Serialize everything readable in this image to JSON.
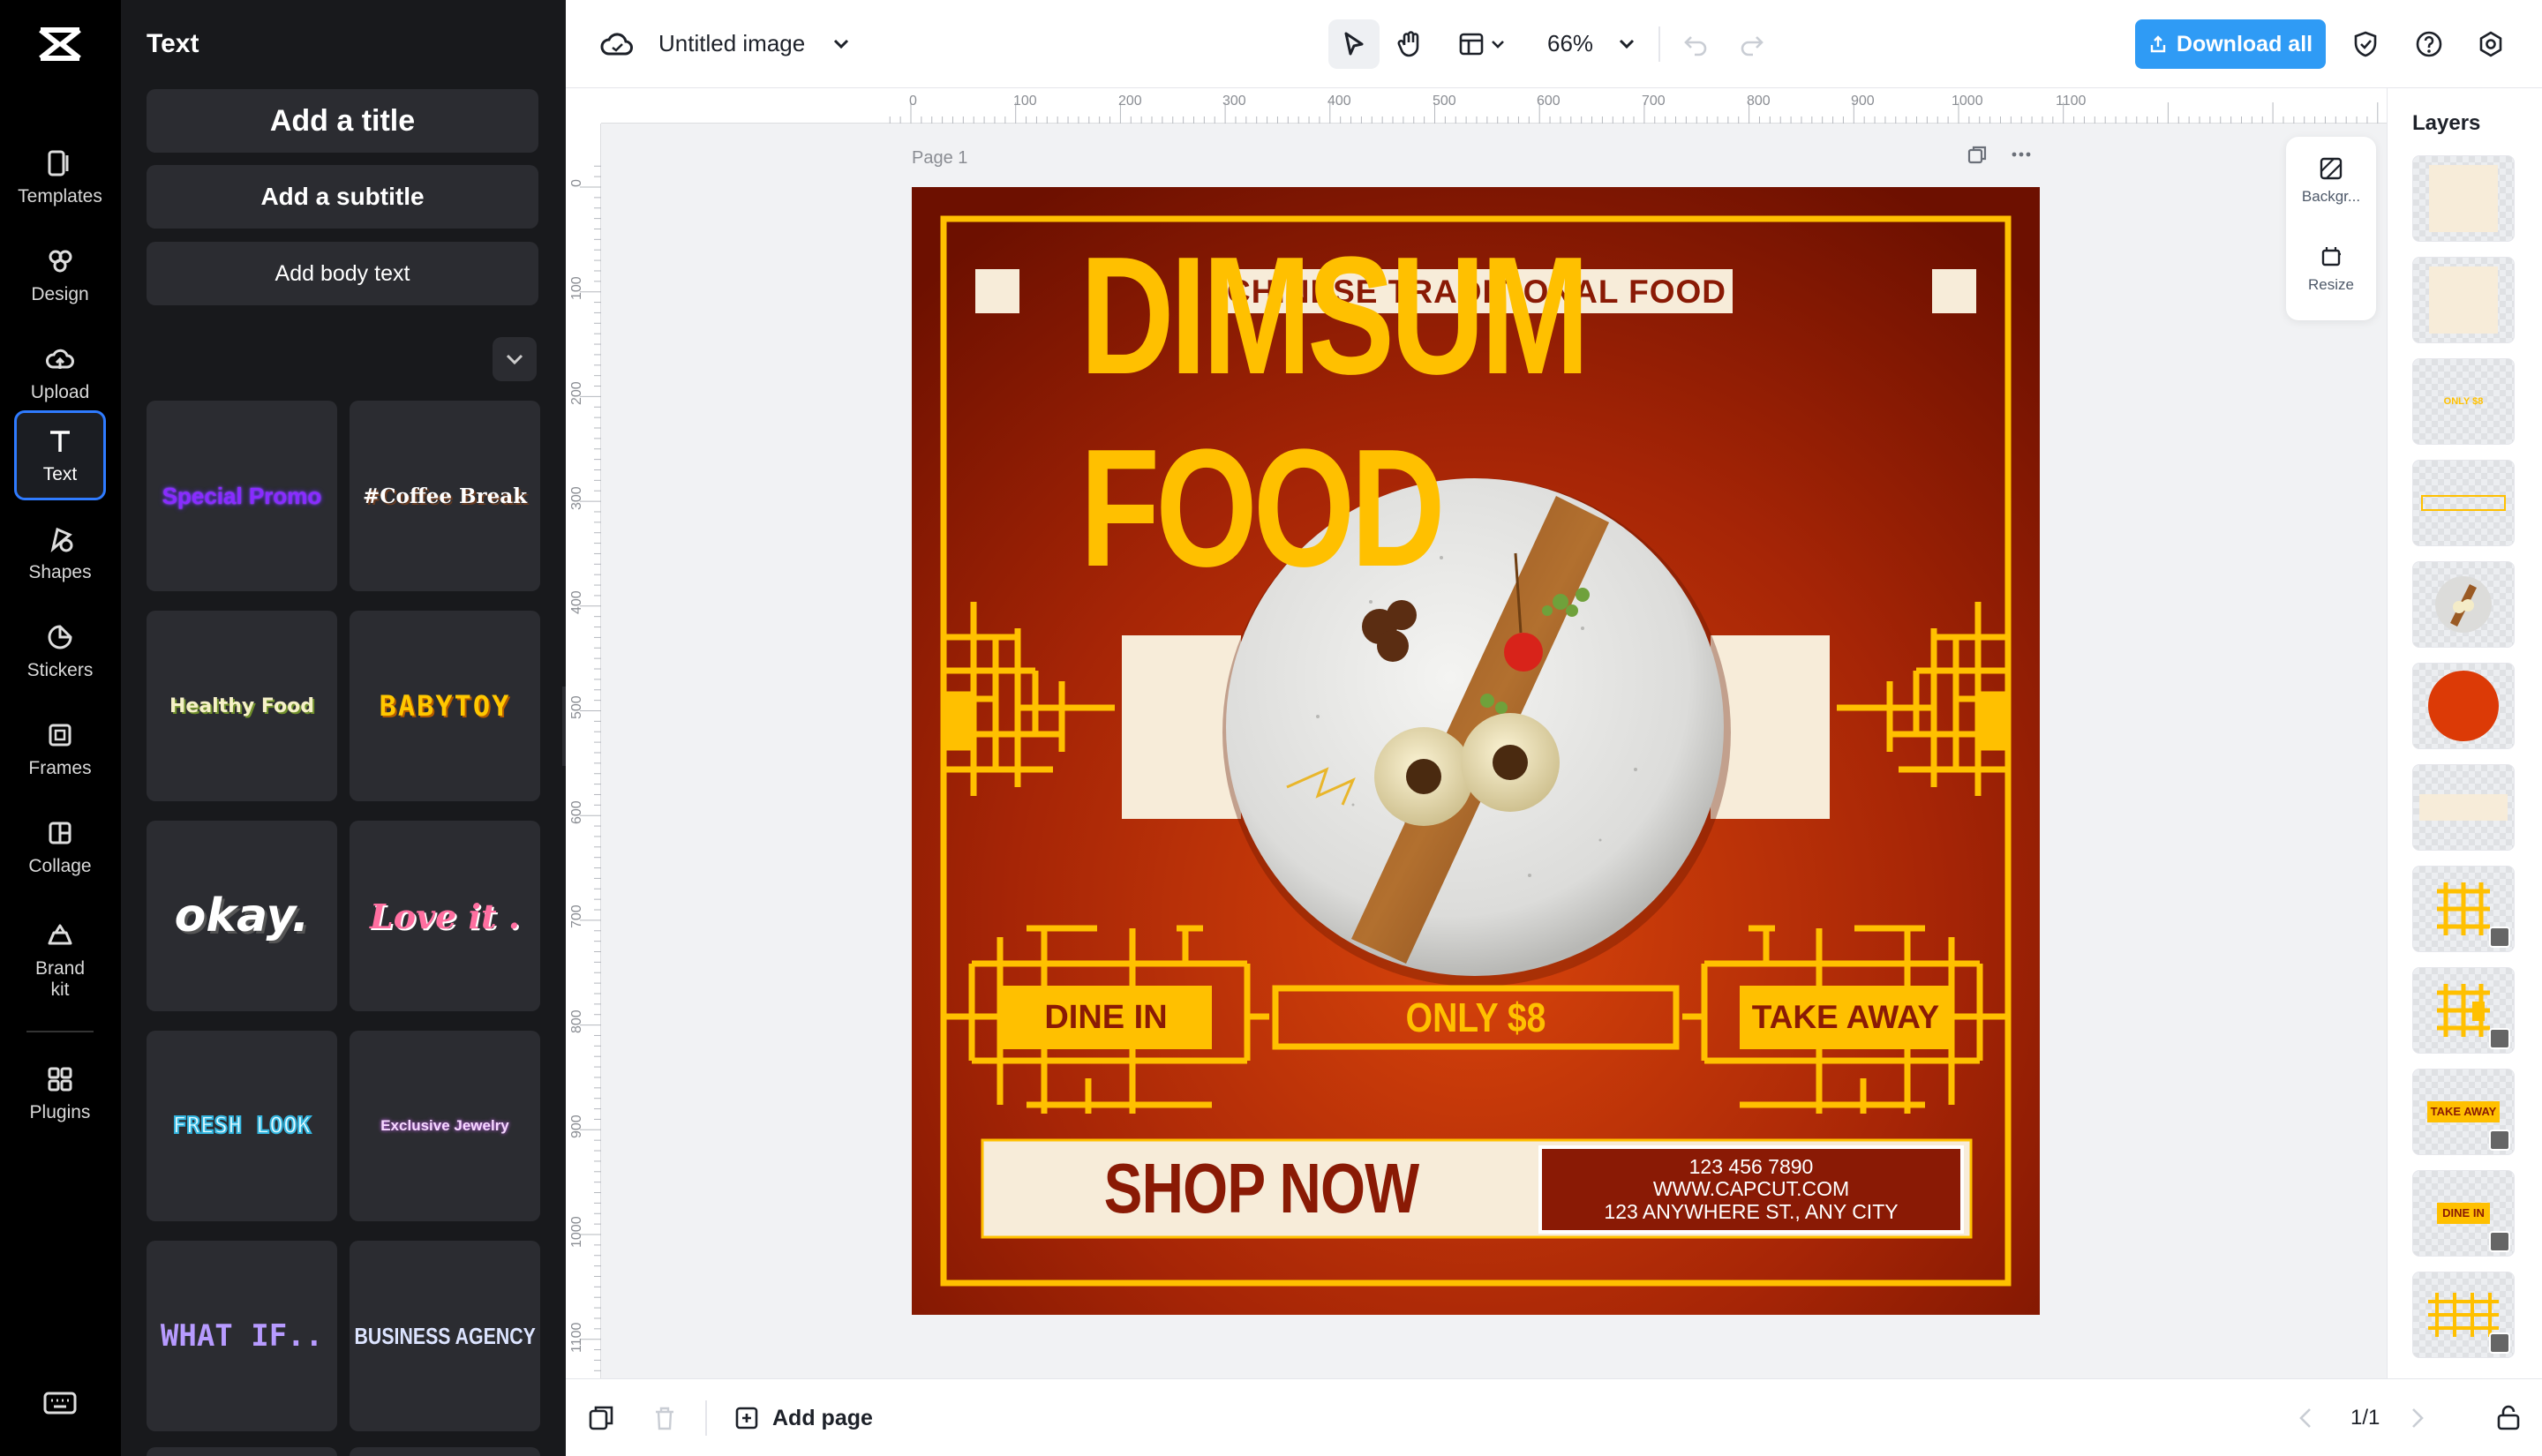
{
  "rail": {
    "items": [
      {
        "label": "Templates",
        "icon": "templates-icon"
      },
      {
        "label": "Design",
        "icon": "design-icon"
      },
      {
        "label": "Upload",
        "icon": "upload-icon"
      },
      {
        "label": "Text",
        "icon": "text-icon"
      },
      {
        "label": "Shapes",
        "icon": "shapes-icon"
      },
      {
        "label": "Stickers",
        "icon": "stickers-icon"
      },
      {
        "label": "Frames",
        "icon": "frames-icon"
      },
      {
        "label": "Collage",
        "icon": "collage-icon"
      },
      {
        "label": "Brand kit",
        "icon": "brand-kit-icon"
      },
      {
        "label": "Plugins",
        "icon": "plugins-icon"
      }
    ],
    "active": "Text"
  },
  "panel": {
    "title": "Text",
    "add_title": "Add a title",
    "add_subtitle": "Add a subtitle",
    "add_body": "Add body text",
    "presets": [
      "Special Promo",
      "#Coffee Break",
      "Healthy Food",
      "BABYTOY",
      "okay.",
      "Love it .",
      "FRESH LOOK",
      "Exclusive Jewelry",
      "WHAT IF..",
      "BUSINESS AGENCY"
    ]
  },
  "topbar": {
    "doc_title": "Untitled image",
    "zoom": "66%",
    "download_label": "Download all"
  },
  "canvas": {
    "page_label": "Page 1",
    "ruler_top": [
      "0",
      "100",
      "200",
      "300",
      "400",
      "500",
      "600",
      "700",
      "800",
      "900",
      "1000",
      "1100"
    ],
    "ruler_left": [
      "0",
      "100",
      "200",
      "300",
      "400",
      "500",
      "600",
      "700",
      "800",
      "900",
      "1000",
      "1100"
    ],
    "side_tools": {
      "background": "Backgr...",
      "resize": "Resize"
    }
  },
  "design": {
    "kicker": "CHINESE TRADITIONAL FOOD",
    "headline": "DIMSUM FOOD",
    "dine_in": "DINE IN",
    "price": "ONLY $8",
    "take_away": "TAKE AWAY",
    "cta": "SHOP NOW",
    "phone": "123 456 7890",
    "website": "WWW.CAPCUT.COM",
    "address": "123 ANYWHERE ST., ANY CITY",
    "colors": {
      "bg_dark": "#7a1400",
      "bg_mid": "#c53a06",
      "gold": "#ffc000",
      "cream": "#f7ecd9",
      "maroon": "#8a1a05"
    }
  },
  "layers": {
    "title": "Layers",
    "thumb_labels": {
      "price": "ONLY $8",
      "take_away": "TAKE AWAY",
      "dine_in": "DINE IN"
    }
  },
  "bottombar": {
    "add_page": "Add page",
    "page_count": "1/1"
  }
}
